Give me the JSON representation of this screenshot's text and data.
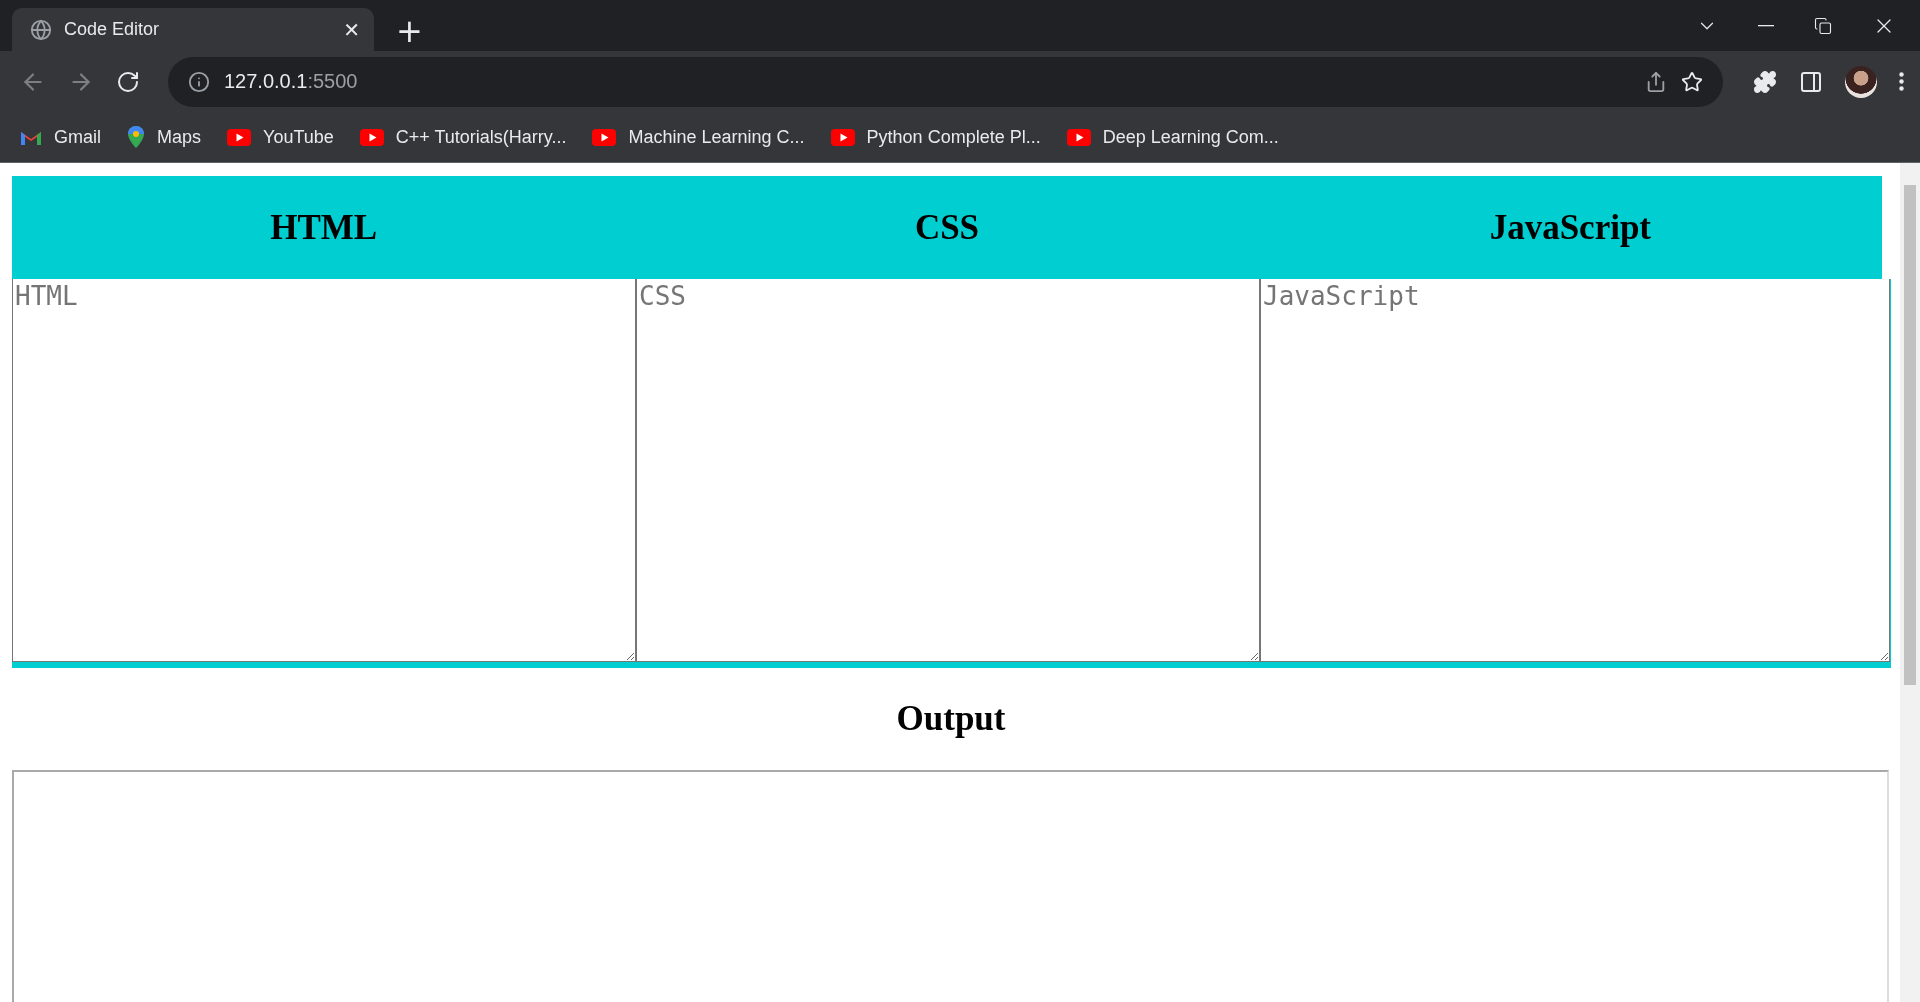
{
  "browser": {
    "tab": {
      "title": "Code Editor",
      "close": "✕"
    },
    "new_tab": "+",
    "address": {
      "host": "127.0.0.1",
      "port": ":5500"
    },
    "bookmarks": [
      {
        "label": "Gmail",
        "kind": "gmail"
      },
      {
        "label": "Maps",
        "kind": "maps"
      },
      {
        "label": "YouTube",
        "kind": "youtube"
      },
      {
        "label": "C++ Tutorials(Harry...",
        "kind": "youtube"
      },
      {
        "label": "Machine Learning C...",
        "kind": "youtube"
      },
      {
        "label": "Python Complete Pl...",
        "kind": "youtube"
      },
      {
        "label": "Deep Learning Com...",
        "kind": "youtube"
      }
    ]
  },
  "editor": {
    "panes": [
      {
        "heading": "HTML",
        "placeholder": "HTML"
      },
      {
        "heading": "CSS",
        "placeholder": "CSS"
      },
      {
        "heading": "JavaScript",
        "placeholder": "JavaScript"
      }
    ]
  },
  "output": {
    "heading": "Output"
  }
}
